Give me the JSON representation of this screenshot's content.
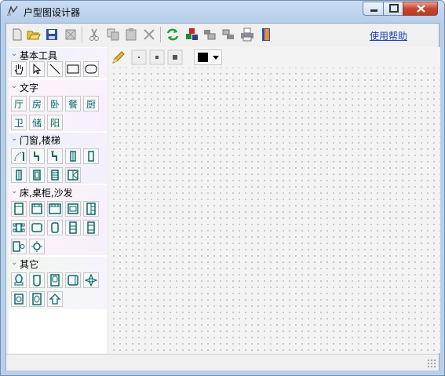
{
  "window": {
    "title": "户型图设计器"
  },
  "toolbar": {
    "items": [
      "new-icon",
      "open-icon",
      "save-icon",
      "print-preview-icon",
      "cut-icon",
      "copy-icon",
      "paste-icon",
      "delete-icon",
      "refresh-icon",
      "color-icon",
      "group-icon",
      "ungroup-icon",
      "print-icon",
      "exit-icon"
    ],
    "help_label": "使用帮助"
  },
  "sidebar": {
    "panels": [
      {
        "label": "基本工具",
        "tools": []
      },
      {
        "label": "文字",
        "tools": [
          "厅",
          "房",
          "卧",
          "餐",
          "厨",
          "卫",
          "储",
          "阳"
        ]
      },
      {
        "label": "门窗,楼梯",
        "tools": []
      },
      {
        "label": "床,桌柜,沙发",
        "tools": []
      },
      {
        "label": "其它",
        "tools": []
      }
    ]
  },
  "canvas_tools": {
    "selected_color": "#000000"
  },
  "colors": {
    "accent": "#1e3fb8",
    "tool_text": "#0b6a6a"
  }
}
